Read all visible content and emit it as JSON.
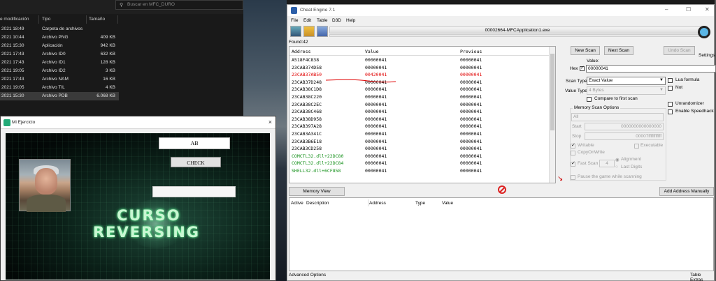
{
  "explorer": {
    "search_placeholder": "Buscar en MFC_DURO",
    "columns": {
      "date": "e modificación",
      "type": "Tipo",
      "size": "Tamaño"
    },
    "rows": [
      {
        "date": "2021 18:49",
        "type": "Carpeta de archivos",
        "size": ""
      },
      {
        "date": "2021 10:44",
        "type": "Archivo PNG",
        "size": "409 KB"
      },
      {
        "date": "2021 15:30",
        "type": "Aplicación",
        "size": "942 KB"
      },
      {
        "date": "2021 17:43",
        "type": "Archivo ID0",
        "size": "632 KB"
      },
      {
        "date": "2021 17:43",
        "type": "Archivo ID1",
        "size": "128 KB"
      },
      {
        "date": "2021 19:05",
        "type": "Archivo ID2",
        "size": "3 KB"
      },
      {
        "date": "2021 17:43",
        "type": "Archivo NAM",
        "size": "16 KB"
      },
      {
        "date": "2021 19:05",
        "type": "Archivo TIL",
        "size": "4 KB"
      },
      {
        "date": "2021 15:30",
        "type": "Archivo PDB",
        "size": "6.068 KB"
      }
    ]
  },
  "mi_window": {
    "title": "Mi Ejercicio",
    "close": "×",
    "input_value": "AB",
    "check_button": "CHECK",
    "banner_line1": "CURSO",
    "banner_line2": "REVERSING"
  },
  "cheat_engine": {
    "title": "Cheat Engine 7.1",
    "menu": [
      "File",
      "Edit",
      "Table",
      "D3D",
      "Help"
    ],
    "process": "00002664-MFCApplication1.exe",
    "found": "Found:42",
    "settings": "Settings",
    "columns": {
      "address": "Address",
      "value": "Value",
      "previous": "Previous"
    },
    "rows": [
      {
        "address": "A518F4C838",
        "value": "00000041",
        "previous": "00000041",
        "style": "normal"
      },
      {
        "address": "23CAB374D58",
        "value": "00000041",
        "previous": "00000041",
        "style": "normal"
      },
      {
        "address": "23CAB37AB50",
        "value": "00420041",
        "previous": "00000041",
        "style": "red"
      },
      {
        "address": "23CAB37D248",
        "value": "00000041",
        "previous": "00000041",
        "style": "normal"
      },
      {
        "address": "23CAB38C1D8",
        "value": "00000041",
        "previous": "00000041",
        "style": "normal"
      },
      {
        "address": "23CAB38C220",
        "value": "00000041",
        "previous": "00000041",
        "style": "normal"
      },
      {
        "address": "23CAB38C2EC",
        "value": "00000041",
        "previous": "00000041",
        "style": "normal"
      },
      {
        "address": "23CAB38C468",
        "value": "00000041",
        "previous": "00000041",
        "style": "normal"
      },
      {
        "address": "23CAB38D958",
        "value": "00000041",
        "previous": "00000041",
        "style": "normal"
      },
      {
        "address": "23CAB397A28",
        "value": "00000041",
        "previous": "00000041",
        "style": "normal"
      },
      {
        "address": "23CAB3A341C",
        "value": "00000041",
        "previous": "00000041",
        "style": "normal"
      },
      {
        "address": "23CAB3B6E18",
        "value": "00000041",
        "previous": "00000041",
        "style": "normal"
      },
      {
        "address": "23CAB3CD258",
        "value": "00000041",
        "previous": "00000041",
        "style": "normal"
      },
      {
        "address": "COMCTL32.dll+22DC80",
        "value": "00000041",
        "previous": "00000041",
        "style": "green"
      },
      {
        "address": "COMCTL32.dll+22DC84",
        "value": "00000041",
        "previous": "00000041",
        "style": "green"
      },
      {
        "address": "SHELL32.dll+6CF858",
        "value": "00000041",
        "previous": "00000041",
        "style": "green"
      }
    ],
    "new_scan": "New Scan",
    "next_scan": "Next Scan",
    "undo_scan": "Undo Scan",
    "value_label": "Value:",
    "hex_label": "Hex",
    "value_input": "00000041",
    "scan_type_label": "Scan Type",
    "scan_type_value": "Exact Value",
    "value_type_label": "Value Type",
    "value_type_value": "4 Bytes",
    "compare_first": "Compare to first scan",
    "lua_formula": "Lua formula",
    "not_label": "Not",
    "memory_options": "Memory Scan Options",
    "all_option": "All",
    "start_label": "Start",
    "start_value": "0000000000000000",
    "stop_label": "Stop",
    "stop_value": "00007fffffffffff",
    "writable": "Writable",
    "executable": "Executable",
    "copy_on_write": "CopyOnWrite",
    "fast_scan": "Fast Scan",
    "fast_scan_value": "4",
    "alignment": "Alignment",
    "last_digits": "Last Digits",
    "pause_game": "Pause the game while scanning",
    "unrandomizer": "Unrandomizer",
    "speedhack": "Enable Speedhack",
    "memory_view": "Memory View",
    "add_address": "Add Address Manually",
    "table_columns": {
      "active": "Active",
      "description": "Description",
      "address": "Address",
      "type": "Type",
      "value": "Value"
    },
    "advanced_options": "Advanced Options",
    "table_extras": "Table Extras"
  }
}
